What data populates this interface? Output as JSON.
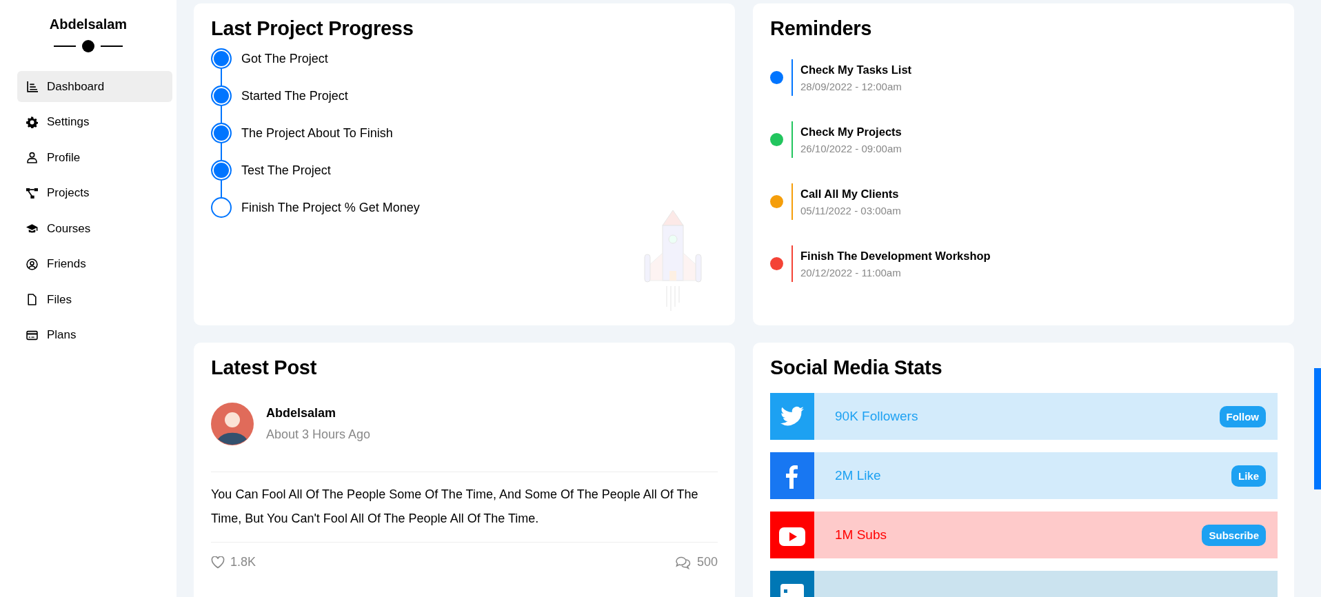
{
  "sidebar": {
    "user_name": "Abdelsalam",
    "items": [
      {
        "label": "Dashboard",
        "kind": "chart",
        "selected": true
      },
      {
        "label": "Settings",
        "kind": "gear",
        "selected": false
      },
      {
        "label": "Profile",
        "kind": "user",
        "selected": false
      },
      {
        "label": "Projects",
        "kind": "nodes",
        "selected": false
      },
      {
        "label": "Courses",
        "kind": "cap",
        "selected": false
      },
      {
        "label": "Friends",
        "kind": "user-circle",
        "selected": false
      },
      {
        "label": "Files",
        "kind": "file",
        "selected": false
      },
      {
        "label": "Plans",
        "kind": "card",
        "selected": false
      }
    ]
  },
  "progress": {
    "title": "Last Project Progress",
    "steps": [
      {
        "label": "Got The Project",
        "done": true
      },
      {
        "label": "Started The Project",
        "done": true
      },
      {
        "label": "The Project About To Finish",
        "done": true
      },
      {
        "label": "Test The Project",
        "done": true
      },
      {
        "label": "Finish The Project % Get Money",
        "done": false
      }
    ]
  },
  "reminders": {
    "title": "Reminders",
    "items": [
      {
        "title": "Check My Tasks List",
        "date": "28/09/2022 - 12:00am",
        "color": "#0075ff"
      },
      {
        "title": "Check My Projects",
        "date": "26/10/2022 - 09:00am",
        "color": "#22c55e"
      },
      {
        "title": "Call All My Clients",
        "date": "05/11/2022 - 03:00am",
        "color": "#f59e0b"
      },
      {
        "title": "Finish The Development Workshop",
        "date": "20/12/2022 - 11:00am",
        "color": "#f44336"
      }
    ]
  },
  "latest_post": {
    "title": "Latest Post",
    "author": "Abdelsalam",
    "time": "About 3 Hours Ago",
    "text": "You Can Fool All Of The People Some Of The Time, And Some Of The People All Of The Time, But You Can't Fool All Of The People All Of The Time.",
    "likes": "1.8K",
    "comments": "500"
  },
  "social": {
    "title": "Social Media Stats",
    "items": [
      {
        "kind": "twitter",
        "stat": "90K Followers",
        "button": "Follow"
      },
      {
        "kind": "facebook",
        "stat": "2M Like",
        "button": "Like"
      },
      {
        "kind": "youtube",
        "stat": "1M Subs",
        "button": "Subscribe"
      },
      {
        "kind": "linkedin"
      }
    ]
  }
}
